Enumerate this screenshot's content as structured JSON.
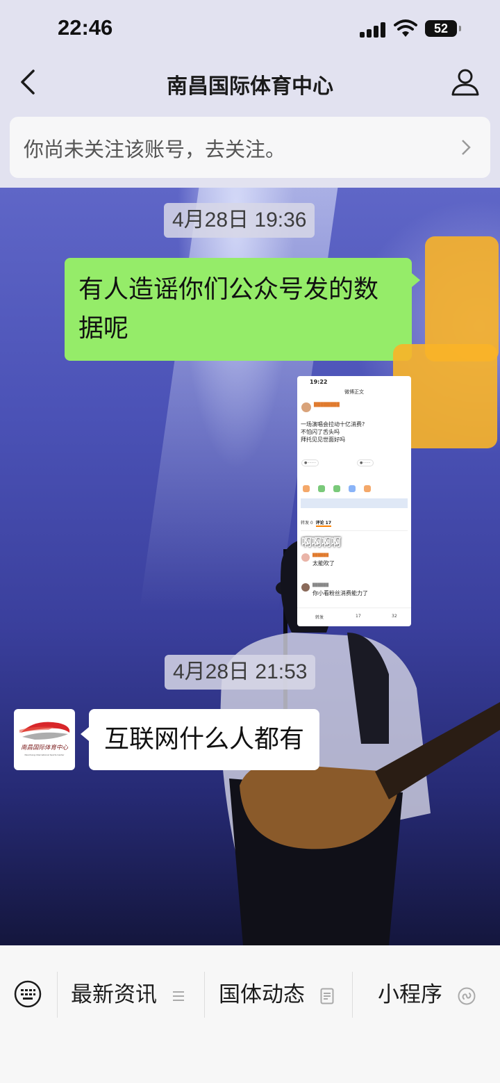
{
  "status_bar": {
    "time": "22:46",
    "battery": "52"
  },
  "nav": {
    "title": "南昌国际体育中心"
  },
  "follow_banner": {
    "text": "你尚未关注该账号，去关注。"
  },
  "chat": {
    "messages": [
      {
        "type": "timestamp",
        "text": "4月28日 19:36"
      },
      {
        "type": "outgoing_text",
        "text": "有人造谣你们公众号发的数据呢"
      },
      {
        "type": "outgoing_image",
        "overlay_text": "啊啊啊啊"
      },
      {
        "type": "timestamp",
        "text": "4月28日 21:53"
      },
      {
        "type": "incoming_text",
        "text": "互联网什么人都有"
      }
    ],
    "screenshot": {
      "status_time": "19:22",
      "header": "微博正文",
      "post_lines": [
        "一场演唱会拉动十亿消费?",
        "不怕闪了舌头吗",
        "拜托见见世面好吗"
      ],
      "tabs": [
        "转发 0",
        "评论 17"
      ],
      "comments": [
        "太能吹了",
        "你小看粉丝消费能力了"
      ],
      "bottom": [
        "转发",
        "17",
        "32"
      ]
    },
    "avatar_logo_text": "南昌国际体育中心",
    "avatar_logo_subtext": "Nanchang International Sports Center"
  },
  "menu": {
    "items": [
      {
        "label": "最新资讯",
        "icon": "list-icon"
      },
      {
        "label": "国体动态",
        "icon": "document-icon"
      },
      {
        "label": "小程序",
        "icon": "mini-program-icon"
      }
    ]
  },
  "colors": {
    "outgoing_bubble": "#95ec69",
    "incoming_bubble": "#ffffff",
    "header_bg": "#e2e2f0"
  }
}
